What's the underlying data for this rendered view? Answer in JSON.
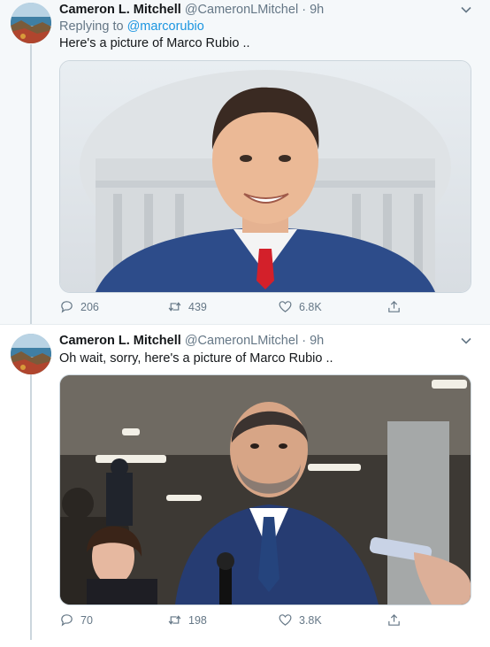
{
  "tweets": [
    {
      "name": "Cameron L. Mitchell",
      "handle": "@CameronLMitchel",
      "separator": "·",
      "time": "9h",
      "replying_prefix": "Replying to",
      "replying_to": "@marcorubio",
      "text": "Here's a picture of Marco Rubio ..",
      "counts": {
        "replies": "206",
        "retweets": "439",
        "likes": "6.8K"
      }
    },
    {
      "name": "Cameron L. Mitchell",
      "handle": "@CameronLMitchel",
      "separator": "·",
      "time": "9h",
      "text": "Oh wait, sorry, here's a picture of Marco Rubio ..",
      "counts": {
        "replies": "70",
        "retweets": "198",
        "likes": "3.8K"
      }
    }
  ],
  "icons": {
    "reply": "reply-icon",
    "retweet": "retweet-icon",
    "like": "heart-icon",
    "share": "share-icon",
    "menu": "chevron-down-icon"
  },
  "colors": {
    "link": "#1b95e0",
    "secondary": "#657786",
    "thread": "#ccd6dd"
  }
}
